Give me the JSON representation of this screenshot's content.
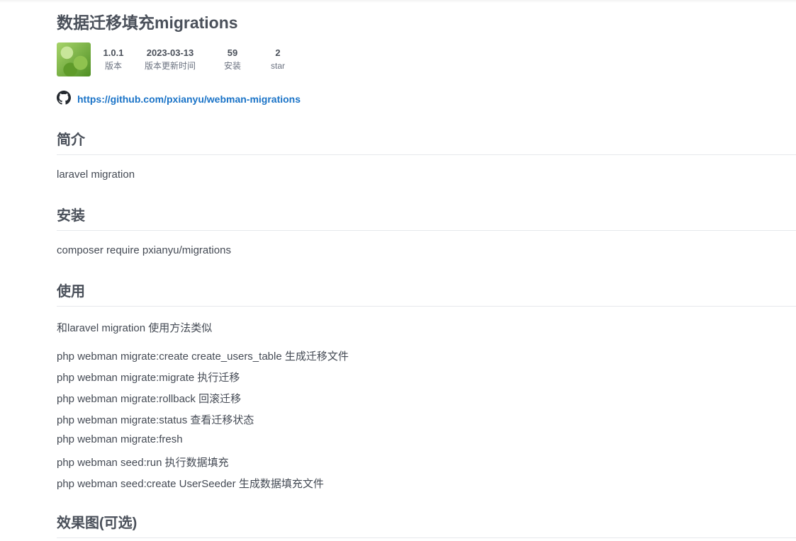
{
  "title": "数据迁移填充migrations",
  "meta": {
    "version_value": "1.0.1",
    "version_label": "版本",
    "updated_value": "2023-03-13",
    "updated_label": "版本更新时间",
    "installs_value": "59",
    "installs_label": "安装",
    "stars_value": "2",
    "stars_label": "star"
  },
  "repo": {
    "icon": "github-icon",
    "url": "https://github.com/pxianyu/webman-migrations"
  },
  "sections": {
    "intro": {
      "heading": "简介",
      "text": "laravel migration"
    },
    "install": {
      "heading": "安装",
      "text": "composer require pxianyu/migrations"
    },
    "usage": {
      "heading": "使用",
      "text": "和laravel migration 使用方法类似",
      "commands": [
        "php webman migrate:create create_users_table 生成迁移文件",
        "php webman migrate:migrate 执行迁移",
        "php webman migrate:rollback 回滚迁移",
        "php webman migrate:status 查看迁移状态",
        "php webman migrate:fresh",
        "php webman seed:run 执行数据填充",
        "php webman seed:create UserSeeder 生成数据填充文件"
      ]
    },
    "screenshots": {
      "heading": "效果图(可选)"
    }
  }
}
